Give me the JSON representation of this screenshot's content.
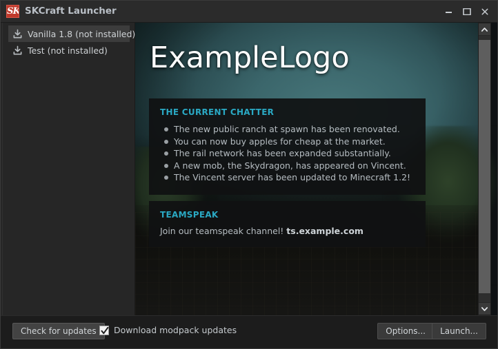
{
  "window": {
    "title": "SKCraft Launcher",
    "app_icon": "skcraft-logo-icon",
    "icon_glyph": "SK",
    "controls": {
      "minimize": "minimize-icon",
      "maximize": "maximize-icon",
      "close": "close-icon"
    }
  },
  "sidebar": {
    "instances": [
      {
        "label": "Vanilla 1.8 (not installed)",
        "icon": "download-icon",
        "selected": true
      },
      {
        "label": "Test (not installed)",
        "icon": "download-icon",
        "selected": false
      }
    ]
  },
  "main": {
    "logo_text": "ExampleLogo",
    "panels": [
      {
        "heading": "THE CURRENT CHATTER",
        "items": [
          "The new public ranch at spawn has been renovated.",
          "You can now buy apples for cheap at the market.",
          "The rail network has been expanded substantially.",
          "A new mob, the Skydragon, has appeared on Vincent.",
          "The Vincent server has been updated to Minecraft 1.2!"
        ]
      },
      {
        "heading": "TEAMSPEAK",
        "text_prefix": "Join our teamspeak channel! ",
        "domain": "ts.example.com"
      }
    ],
    "scrollbar": {
      "up_icon": "chevron-up-icon",
      "down_icon": "chevron-down-icon",
      "thumb": "scrollbar-thumb"
    }
  },
  "bottom_bar": {
    "check_updates_label": "Check for updates",
    "checkbox": {
      "label": "Download modpack updates",
      "checked": true
    },
    "options_label": "Options...",
    "launch_label": "Launch..."
  },
  "colors": {
    "accent_heading": "#2aa9c4",
    "title_text": "#b9bfc6",
    "body_text": "#b6bdc2",
    "window_bg": "#262626",
    "bottom_bar_bg": "#1c1c1c",
    "icon_red": "#c0392b"
  }
}
